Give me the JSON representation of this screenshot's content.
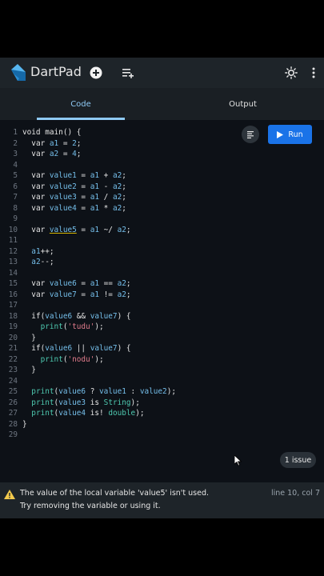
{
  "app": {
    "title": "DartPad"
  },
  "icons": [
    "dart-logo-icon",
    "new-pad-icon",
    "samples-menu-icon",
    "theme-toggle-icon",
    "overflow-menu-icon",
    "format-icon",
    "play-icon",
    "warning-icon",
    "mouse-cursor-icon"
  ],
  "tabs": [
    {
      "label": "Code",
      "active": true
    },
    {
      "label": "Output",
      "active": false
    }
  ],
  "editor": {
    "run_label": "Run",
    "lines": [
      "void main() {",
      "  var a1 = 2;",
      "  var a2 = 4;",
      "",
      "  var value1 = a1 + a2;",
      "  var value2 = a1 - a2;",
      "  var value3 = a1 / a2;",
      "  var value4 = a1 * a2;",
      "",
      "  var value5 = a1 ~/ a2;",
      "",
      "  a1++;",
      "  a2--;",
      "",
      "  var value6 = a1 == a2;",
      "  var value7 = a1 != a2;",
      "",
      "  if(value6 && value7) {",
      "    print('tudu');",
      "  }",
      "  if(value6 || value7) {",
      "    print('nodu');",
      "  }",
      "",
      "  print(value6 ? value1 : value2);",
      "  print(value3 is String);",
      "  print(value4 is! double);",
      "}",
      ""
    ]
  },
  "issues": {
    "badge": "1 issue",
    "message": "The value of the local variable 'value5' isn't used.",
    "hint": "Try removing the variable or using it.",
    "position": "line 10, col 7"
  },
  "colors": {
    "accent": "#1a73e8",
    "tab_active": "#8fc9f4",
    "warning": "#f2c94c",
    "background": "#0e1216"
  }
}
